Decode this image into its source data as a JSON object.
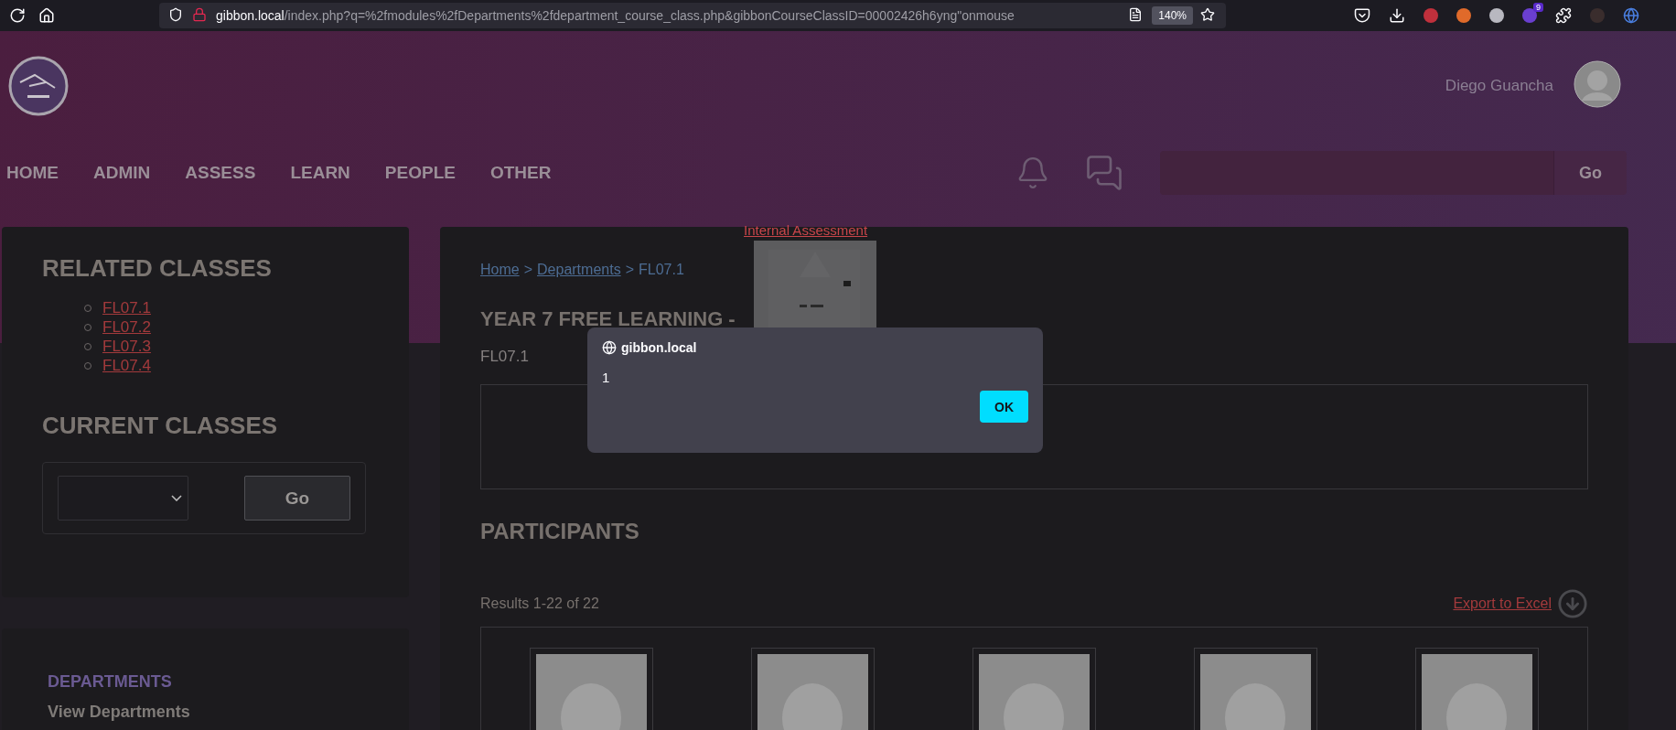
{
  "browser": {
    "url": {
      "host": "gibbon.local",
      "path": "/index.php?q=%2fmodules%2fDepartments%2fdepartment_course_class.php&gibbonCourseClassID=00002426h6yng\"onmouse"
    },
    "zoom": "140%",
    "extension_badge": "9"
  },
  "header": {
    "user_name": "Diego Guancha"
  },
  "nav": {
    "items": [
      "HOME",
      "ADMIN",
      "ASSESS",
      "LEARN",
      "PEOPLE",
      "OTHER"
    ],
    "search_button": "Go"
  },
  "sidebar": {
    "related_title": "RELATED CLASSES",
    "related_classes": [
      "FL07.1",
      "FL07.2",
      "FL07.3",
      "FL07.4"
    ],
    "current_title": "CURRENT CLASSES",
    "current_button": "Go",
    "menu_heading": "DEPARTMENTS",
    "menu_items": [
      "View Departments"
    ]
  },
  "main": {
    "breadcrumb": [
      {
        "kind": "link",
        "label": "Home"
      },
      {
        "kind": "separator",
        "label": ">"
      },
      {
        "kind": "link",
        "label": "Departments"
      },
      {
        "kind": "separator",
        "label": ">"
      },
      {
        "kind": "current",
        "label": "FL07.1"
      }
    ],
    "title": "YEAR 7 FREE LEARNING -",
    "class_code": "FL07.1",
    "participants_title": "PARTICIPANTS",
    "results": "Results 1-22 of 22",
    "export_link": "Export to Excel",
    "photos": [
      {
        "kind": "placeholder"
      },
      {
        "kind": "placeholder"
      },
      {
        "kind": "placeholder"
      },
      {
        "kind": "placeholder"
      },
      {
        "kind": "placeholder"
      }
    ]
  },
  "overlay": {
    "link": "Internal Assessment"
  },
  "alert": {
    "origin": "gibbon.local",
    "message": "1",
    "button": "OK"
  }
}
